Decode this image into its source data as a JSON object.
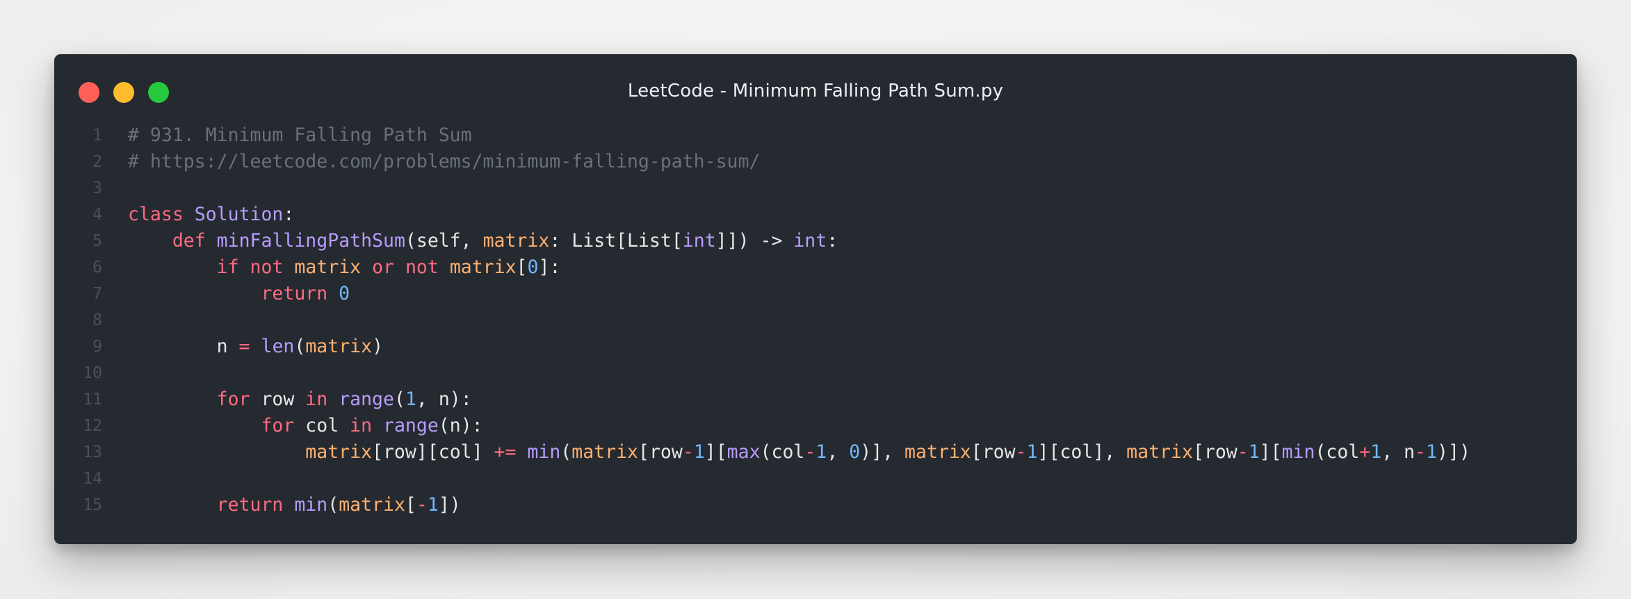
{
  "window": {
    "title": "LeetCode - Minimum Falling Path Sum.py",
    "controls": [
      "close",
      "minimize",
      "maximize"
    ]
  },
  "colors": {
    "background": "#252a30",
    "comment": "#6a7078",
    "keyword": "#ff6b81",
    "function": "#b89cff",
    "variable": "#ffb070",
    "number": "#6fb8ff",
    "text": "#e6e6e6",
    "line_number": "#4a5058"
  },
  "editor": {
    "language": "python",
    "lines": [
      {
        "number": "1",
        "tokens": [
          {
            "t": "cm",
            "v": "# 931. Minimum Falling Path Sum"
          }
        ]
      },
      {
        "number": "2",
        "tokens": [
          {
            "t": "cm",
            "v": "# https://leetcode.com/problems/minimum-falling-path-sum/"
          }
        ]
      },
      {
        "number": "3",
        "tokens": []
      },
      {
        "number": "4",
        "tokens": [
          {
            "t": "kw",
            "v": "class"
          },
          {
            "t": "p",
            "v": " "
          },
          {
            "t": "cls",
            "v": "Solution"
          },
          {
            "t": "p",
            "v": ":"
          }
        ]
      },
      {
        "number": "5",
        "tokens": [
          {
            "t": "p",
            "v": "    "
          },
          {
            "t": "kw",
            "v": "def"
          },
          {
            "t": "p",
            "v": " "
          },
          {
            "t": "fn",
            "v": "minFallingPathSum"
          },
          {
            "t": "p",
            "v": "(self, "
          },
          {
            "t": "var",
            "v": "matrix"
          },
          {
            "t": "p",
            "v": ": List[List["
          },
          {
            "t": "bi",
            "v": "int"
          },
          {
            "t": "p",
            "v": "]]) -> "
          },
          {
            "t": "bi",
            "v": "int"
          },
          {
            "t": "p",
            "v": ":"
          }
        ]
      },
      {
        "number": "6",
        "tokens": [
          {
            "t": "p",
            "v": "        "
          },
          {
            "t": "kw",
            "v": "if"
          },
          {
            "t": "p",
            "v": " "
          },
          {
            "t": "kw",
            "v": "not"
          },
          {
            "t": "p",
            "v": " "
          },
          {
            "t": "var",
            "v": "matrix"
          },
          {
            "t": "p",
            "v": " "
          },
          {
            "t": "kw",
            "v": "or"
          },
          {
            "t": "p",
            "v": " "
          },
          {
            "t": "kw",
            "v": "not"
          },
          {
            "t": "p",
            "v": " "
          },
          {
            "t": "var",
            "v": "matrix"
          },
          {
            "t": "p",
            "v": "["
          },
          {
            "t": "num",
            "v": "0"
          },
          {
            "t": "p",
            "v": "]:"
          }
        ]
      },
      {
        "number": "7",
        "tokens": [
          {
            "t": "p",
            "v": "            "
          },
          {
            "t": "kw",
            "v": "return"
          },
          {
            "t": "p",
            "v": " "
          },
          {
            "t": "num",
            "v": "0"
          }
        ]
      },
      {
        "number": "8",
        "tokens": []
      },
      {
        "number": "9",
        "tokens": [
          {
            "t": "p",
            "v": "        n "
          },
          {
            "t": "op",
            "v": "="
          },
          {
            "t": "p",
            "v": " "
          },
          {
            "t": "bi",
            "v": "len"
          },
          {
            "t": "p",
            "v": "("
          },
          {
            "t": "var",
            "v": "matrix"
          },
          {
            "t": "p",
            "v": ")"
          }
        ]
      },
      {
        "number": "10",
        "tokens": []
      },
      {
        "number": "11",
        "tokens": [
          {
            "t": "p",
            "v": "        "
          },
          {
            "t": "kw",
            "v": "for"
          },
          {
            "t": "p",
            "v": " row "
          },
          {
            "t": "kw",
            "v": "in"
          },
          {
            "t": "p",
            "v": " "
          },
          {
            "t": "bi",
            "v": "range"
          },
          {
            "t": "p",
            "v": "("
          },
          {
            "t": "num",
            "v": "1"
          },
          {
            "t": "p",
            "v": ", n):"
          }
        ]
      },
      {
        "number": "12",
        "tokens": [
          {
            "t": "p",
            "v": "            "
          },
          {
            "t": "kw",
            "v": "for"
          },
          {
            "t": "p",
            "v": " col "
          },
          {
            "t": "kw",
            "v": "in"
          },
          {
            "t": "p",
            "v": " "
          },
          {
            "t": "bi",
            "v": "range"
          },
          {
            "t": "p",
            "v": "(n):"
          }
        ]
      },
      {
        "number": "13",
        "tokens": [
          {
            "t": "p",
            "v": "                "
          },
          {
            "t": "var",
            "v": "matrix"
          },
          {
            "t": "p",
            "v": "[row][col] "
          },
          {
            "t": "op",
            "v": "+="
          },
          {
            "t": "p",
            "v": " "
          },
          {
            "t": "bi",
            "v": "min"
          },
          {
            "t": "p",
            "v": "("
          },
          {
            "t": "var",
            "v": "matrix"
          },
          {
            "t": "p",
            "v": "[row"
          },
          {
            "t": "op",
            "v": "-"
          },
          {
            "t": "num",
            "v": "1"
          },
          {
            "t": "p",
            "v": "]["
          },
          {
            "t": "bi",
            "v": "max"
          },
          {
            "t": "p",
            "v": "(col"
          },
          {
            "t": "op",
            "v": "-"
          },
          {
            "t": "num",
            "v": "1"
          },
          {
            "t": "p",
            "v": ", "
          },
          {
            "t": "num",
            "v": "0"
          },
          {
            "t": "p",
            "v": ")], "
          },
          {
            "t": "var",
            "v": "matrix"
          },
          {
            "t": "p",
            "v": "[row"
          },
          {
            "t": "op",
            "v": "-"
          },
          {
            "t": "num",
            "v": "1"
          },
          {
            "t": "p",
            "v": "][col], "
          },
          {
            "t": "var",
            "v": "matrix"
          },
          {
            "t": "p",
            "v": "[row"
          },
          {
            "t": "op",
            "v": "-"
          },
          {
            "t": "num",
            "v": "1"
          },
          {
            "t": "p",
            "v": "]["
          },
          {
            "t": "bi",
            "v": "min"
          },
          {
            "t": "p",
            "v": "(col"
          },
          {
            "t": "op",
            "v": "+"
          },
          {
            "t": "num",
            "v": "1"
          },
          {
            "t": "p",
            "v": ", n"
          },
          {
            "t": "op",
            "v": "-"
          },
          {
            "t": "num",
            "v": "1"
          },
          {
            "t": "p",
            "v": ")])"
          }
        ]
      },
      {
        "number": "14",
        "tokens": []
      },
      {
        "number": "15",
        "tokens": [
          {
            "t": "p",
            "v": "        "
          },
          {
            "t": "kw",
            "v": "return"
          },
          {
            "t": "p",
            "v": " "
          },
          {
            "t": "bi",
            "v": "min"
          },
          {
            "t": "p",
            "v": "("
          },
          {
            "t": "var",
            "v": "matrix"
          },
          {
            "t": "p",
            "v": "["
          },
          {
            "t": "op",
            "v": "-"
          },
          {
            "t": "num",
            "v": "1"
          },
          {
            "t": "p",
            "v": "])"
          }
        ]
      }
    ]
  }
}
